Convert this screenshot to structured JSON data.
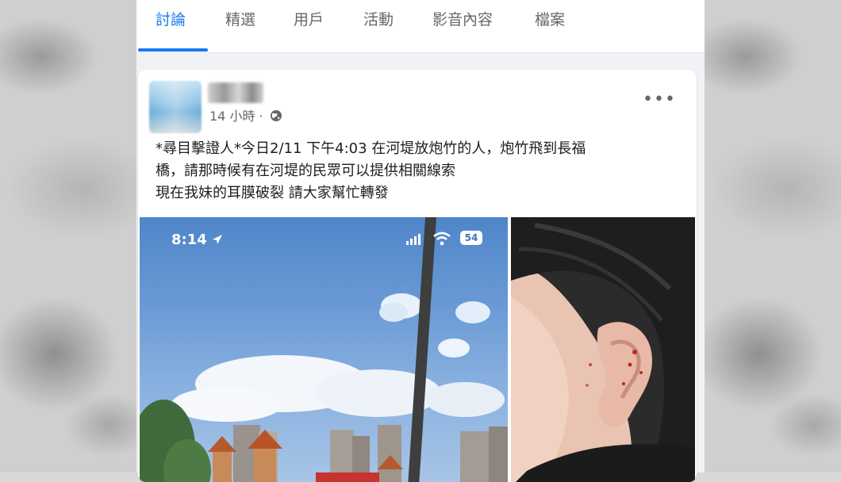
{
  "tabs": [
    {
      "label": "討論",
      "active": true
    },
    {
      "label": "精選",
      "active": false
    },
    {
      "label": "用戶",
      "active": false
    },
    {
      "label": "活動",
      "active": false
    },
    {
      "label": "影音內容",
      "active": false
    },
    {
      "label": "檔案",
      "active": false
    }
  ],
  "post": {
    "timestamp": "14 小時 · ",
    "privacy_icon": "globe-icon",
    "more_label": "•••",
    "text_lines": [
      "*尋目擊證人*今日2/11 下午4:03 在河堤放炮竹的人，炮竹飛到長福",
      "橋，請那時候有在河堤的民眾可以提供相關線索",
      "現在我妹的耳膜破裂 請大家幫忙轉發"
    ],
    "photo_left": {
      "status_time": "8:14",
      "battery": "54"
    }
  },
  "colors": {
    "accent": "#1877f2",
    "muted_text": "#65676b",
    "body_text": "#1c1e21"
  }
}
